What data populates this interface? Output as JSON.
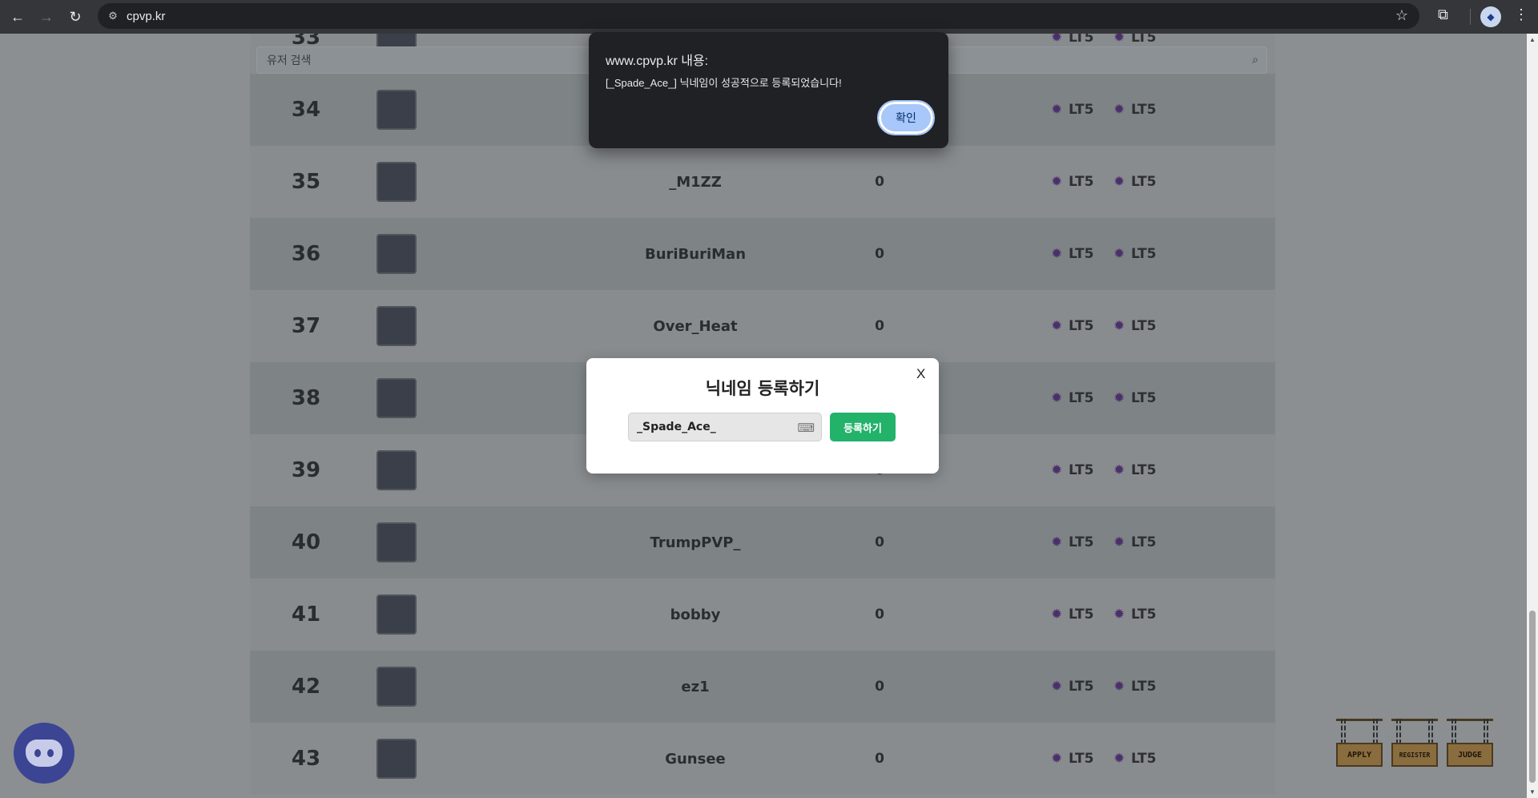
{
  "browser": {
    "url": "cpvp.kr",
    "back_icon": "←",
    "forward_icon": "→",
    "reload_icon": "↻",
    "site_info_icon": "⚙",
    "star_icon": "☆",
    "extensions_icon": "⧉",
    "profile_icon": "◆",
    "menu_icon": "⋮"
  },
  "search": {
    "placeholder": "유저 검색",
    "icon": "⌕"
  },
  "ranking": {
    "rows": [
      {
        "rank": "33",
        "name": "",
        "points": "",
        "tier1": "LT5",
        "tier2": "LT5"
      },
      {
        "rank": "34",
        "name": "",
        "points": "",
        "tier1": "LT5",
        "tier2": "LT5"
      },
      {
        "rank": "35",
        "name": "_M1ZZ",
        "points": "0",
        "tier1": "LT5",
        "tier2": "LT5"
      },
      {
        "rank": "36",
        "name": "BuriBuriMan",
        "points": "0",
        "tier1": "LT5",
        "tier2": "LT5"
      },
      {
        "rank": "37",
        "name": "Over_Heat",
        "points": "0",
        "tier1": "LT5",
        "tier2": "LT5"
      },
      {
        "rank": "38",
        "name": "",
        "points": "",
        "tier1": "LT5",
        "tier2": "LT5"
      },
      {
        "rank": "39",
        "name": "",
        "points": "0",
        "tier1": "LT5",
        "tier2": "LT5"
      },
      {
        "rank": "40",
        "name": "TrumpPVP_",
        "points": "0",
        "tier1": "LT5",
        "tier2": "LT5"
      },
      {
        "rank": "41",
        "name": "bobby",
        "points": "0",
        "tier1": "LT5",
        "tier2": "LT5"
      },
      {
        "rank": "42",
        "name": "ez1",
        "points": "0",
        "tier1": "LT5",
        "tier2": "LT5"
      },
      {
        "rank": "43",
        "name": "Gunsee",
        "points": "0",
        "tier1": "LT5",
        "tier2": "LT5"
      }
    ]
  },
  "modal": {
    "title": "닉네임 등록하기",
    "close_label": "X",
    "nickname_value": "_Spade_Ace_",
    "keyboard_icon": "⌨",
    "register_label": "등록하기"
  },
  "alert": {
    "title": "www.cpvp.kr 내용:",
    "message": "[_Spade_Ace_] 닉네임이 성공적으로 등록되었습니다!",
    "ok_label": "확인"
  },
  "signs": {
    "apply": "APPLY",
    "register": "REGISTER",
    "judge": "JUDGE"
  },
  "colors": {
    "register_button": "#22b26a",
    "alert_ok": "#a8c7fa",
    "discord": "#3b4593"
  }
}
